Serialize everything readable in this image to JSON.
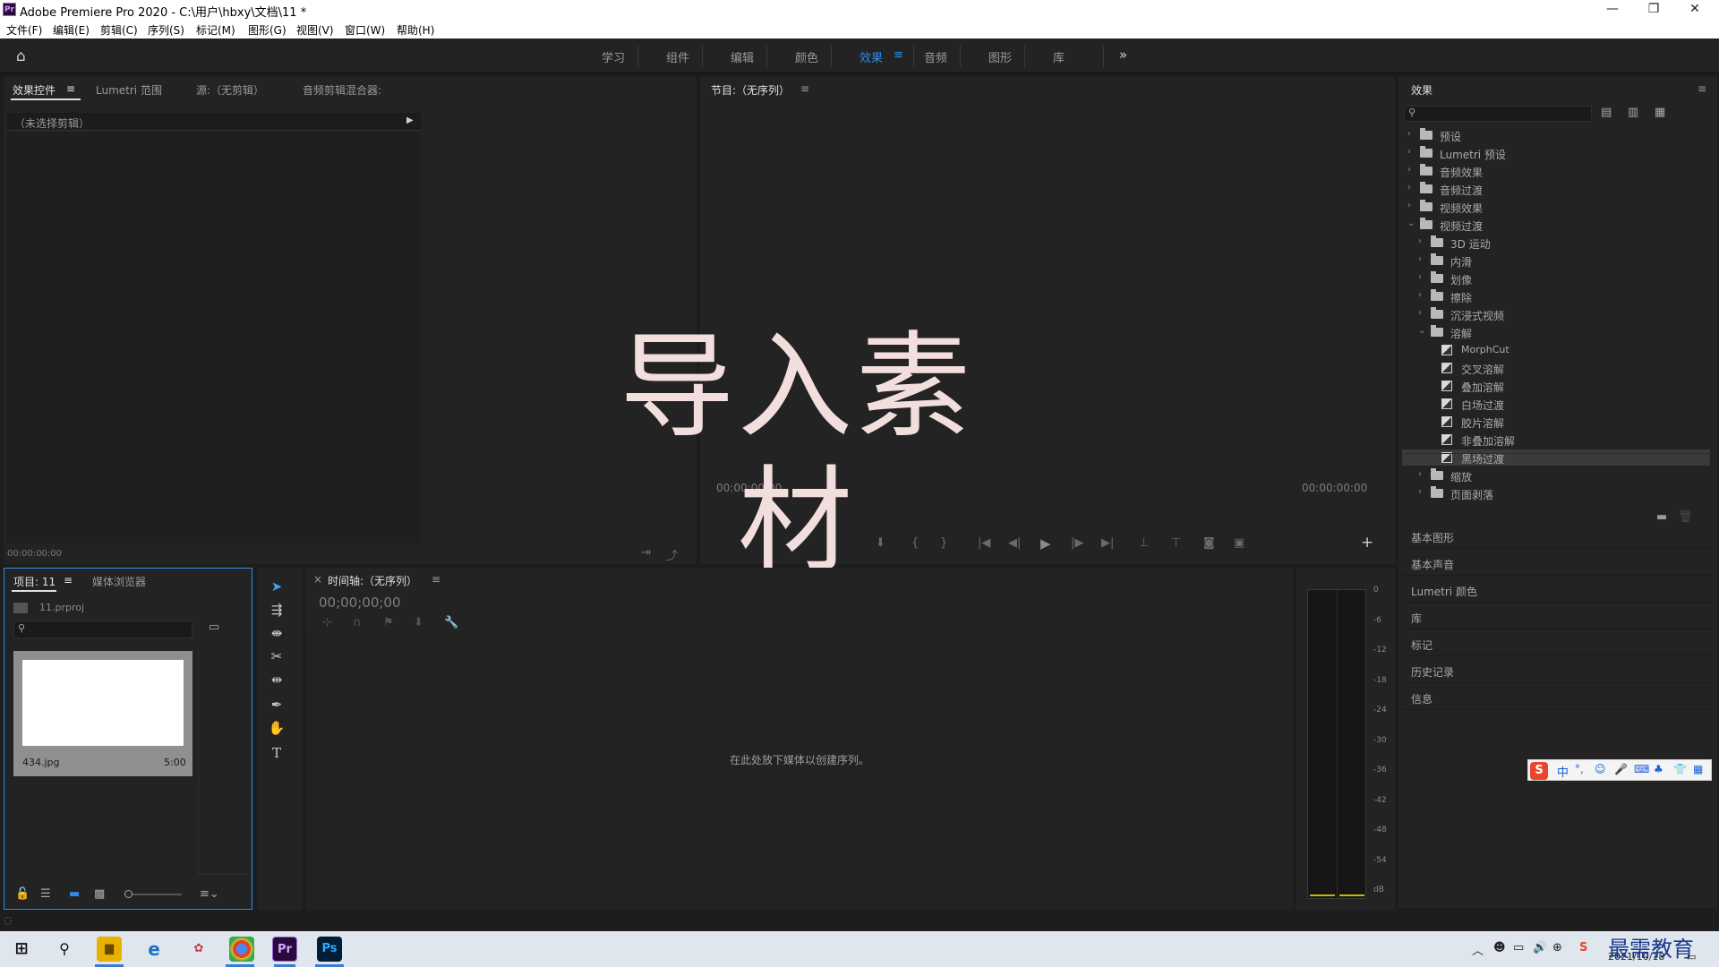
{
  "window": {
    "title": "Adobe Premiere Pro 2020 - C:\\用户\\hbxy\\文档\\11 *",
    "app_icon": "Pr"
  },
  "menu": [
    "文件(F)",
    "编辑(E)",
    "剪辑(C)",
    "序列(S)",
    "标记(M)",
    "图形(G)",
    "视图(V)",
    "窗口(W)",
    "帮助(H)"
  ],
  "workspaces": {
    "items": [
      "学习",
      "组件",
      "编辑",
      "颜色",
      "效果",
      "音频",
      "图形",
      "库"
    ],
    "active": "效果",
    "more": "»"
  },
  "source_panel": {
    "tabs": [
      "效果控件",
      "Lumetri 范围",
      "源:（无剪辑）",
      "音频剪辑混合器:"
    ],
    "no_clip": "（未选择剪辑）",
    "timecode": "00:00:00:00"
  },
  "program_panel": {
    "title": "节目:（无序列）",
    "overlay_text": "导入素材",
    "timecode_left": "00:00:00:00",
    "timecode_right": "00:00:00:00"
  },
  "effects_panel": {
    "title": "效果",
    "tree": [
      {
        "label": "预设",
        "level": 0,
        "kind": "folder-star",
        "expanded": false
      },
      {
        "label": "Lumetri 预设",
        "level": 0,
        "kind": "folder-star",
        "expanded": false
      },
      {
        "label": "音频效果",
        "level": 0,
        "kind": "folder",
        "expanded": false
      },
      {
        "label": "音频过渡",
        "level": 0,
        "kind": "folder",
        "expanded": false
      },
      {
        "label": "视频效果",
        "level": 0,
        "kind": "folder",
        "expanded": false
      },
      {
        "label": "视频过渡",
        "level": 0,
        "kind": "folder",
        "expanded": true
      },
      {
        "label": "3D 运动",
        "level": 1,
        "kind": "folder",
        "expanded": false
      },
      {
        "label": "内滑",
        "level": 1,
        "kind": "folder",
        "expanded": false
      },
      {
        "label": "划像",
        "level": 1,
        "kind": "folder",
        "expanded": false
      },
      {
        "label": "擦除",
        "level": 1,
        "kind": "folder",
        "expanded": false
      },
      {
        "label": "沉浸式视频",
        "level": 1,
        "kind": "folder",
        "expanded": false
      },
      {
        "label": "溶解",
        "level": 1,
        "kind": "folder",
        "expanded": true
      },
      {
        "label": "MorphCut",
        "level": 2,
        "kind": "effect"
      },
      {
        "label": "交叉溶解",
        "level": 2,
        "kind": "effect"
      },
      {
        "label": "叠加溶解",
        "level": 2,
        "kind": "effect"
      },
      {
        "label": "白场过渡",
        "level": 2,
        "kind": "effect"
      },
      {
        "label": "胶片溶解",
        "level": 2,
        "kind": "effect"
      },
      {
        "label": "非叠加溶解",
        "level": 2,
        "kind": "effect"
      },
      {
        "label": "黑场过渡",
        "level": 2,
        "kind": "effect",
        "selected": true
      },
      {
        "label": "缩放",
        "level": 1,
        "kind": "folder",
        "expanded": false
      },
      {
        "label": "页面剥落",
        "level": 1,
        "kind": "folder",
        "expanded": false
      }
    ],
    "collapsed_panels": [
      "基本图形",
      "基本声音",
      "Lumetri 颜色",
      "库",
      "标记",
      "历史记录",
      "信息"
    ]
  },
  "project_panel": {
    "tabs": [
      "项目: 11",
      "媒体浏览器"
    ],
    "project_file": "11.prproj",
    "clip_name": "434.jpg",
    "clip_duration": "5:00"
  },
  "timeline_panel": {
    "title": "时间轴:（无序列）",
    "timecode": "00;00;00;00",
    "empty_hint": "在此处放下媒体以创建序列。"
  },
  "audio_meter": {
    "ticks": [
      "0",
      "-6",
      "-12",
      "-18",
      "-24",
      "-30",
      "-36",
      "-42",
      "-48",
      "-54",
      "dB"
    ]
  },
  "ime": {
    "label": "中"
  },
  "taskbar": {
    "date": "2021/10/18",
    "watermark": "最需教育"
  },
  "colors": {
    "accent": "#2d8ceb",
    "panel": "#232323",
    "overlay_text": "#f3dede"
  }
}
